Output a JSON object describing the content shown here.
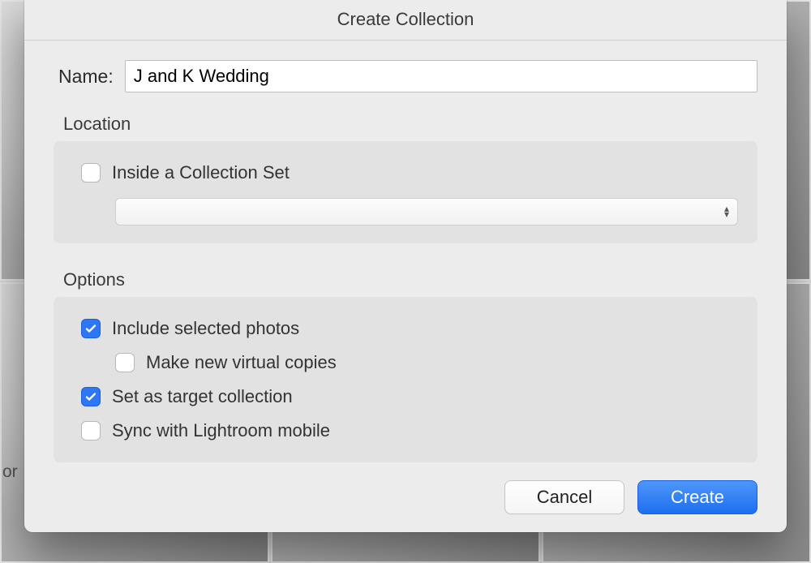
{
  "bg_hint": "or",
  "dialog": {
    "title": "Create Collection",
    "name_label": "Name:",
    "name_value": "J and K Wedding",
    "location": {
      "section_title": "Location",
      "inside_label": "Inside a Collection Set",
      "inside_checked": false,
      "dropdown_value": ""
    },
    "options": {
      "section_title": "Options",
      "items": [
        {
          "key": "include_selected",
          "label": "Include selected photos",
          "checked": true,
          "indent": false
        },
        {
          "key": "virtual_copies",
          "label": "Make new virtual copies",
          "checked": false,
          "indent": true
        },
        {
          "key": "target_collection",
          "label": "Set as target collection",
          "checked": true,
          "indent": false
        },
        {
          "key": "sync_mobile",
          "label": "Sync with Lightroom mobile",
          "checked": false,
          "indent": false
        }
      ]
    },
    "buttons": {
      "cancel": "Cancel",
      "create": "Create"
    }
  },
  "colors": {
    "accent": "#2d76f6",
    "dialog_bg": "#ececec",
    "section_bg": "#e2e2e2"
  }
}
